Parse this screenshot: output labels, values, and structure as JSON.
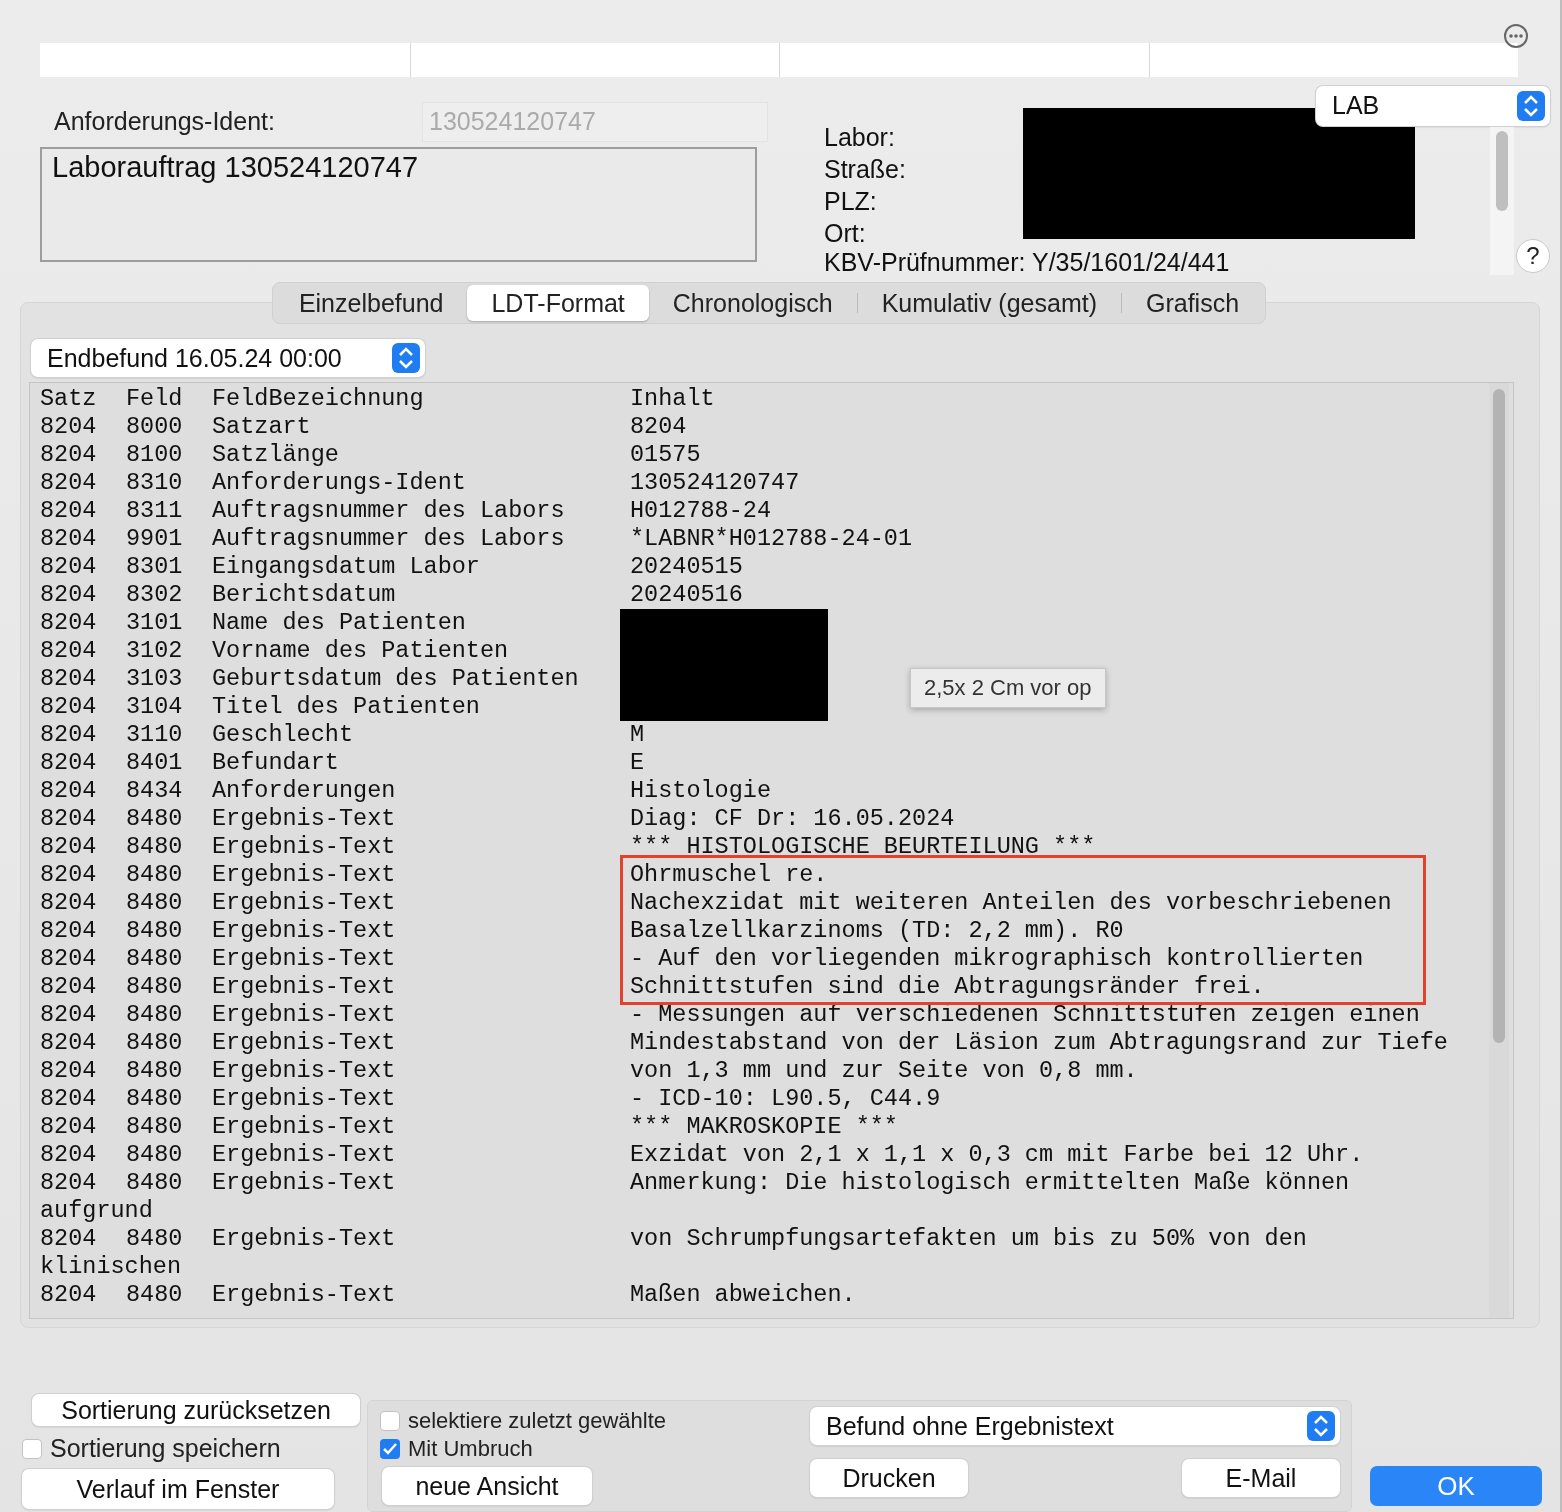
{
  "header": {
    "ident_label": "Anforderungs-Ident:",
    "ident_value": "130524120747",
    "order_text": "Laborauftrag 130524120747",
    "lab_labels": [
      "Labor:",
      "Straße:",
      "PLZ:",
      "Ort:"
    ],
    "kbv_label": "KBV-Prüfnummer:",
    "kbv_value": "Y/35/1601/24/441",
    "lab_select": "LAB",
    "help": "?"
  },
  "tabs": [
    {
      "label": "Einzelbefund",
      "selected": false
    },
    {
      "label": "LDT-Format",
      "selected": true
    },
    {
      "label": "Chronologisch",
      "selected": false
    },
    {
      "label": "Kumulativ (gesamt)",
      "selected": false
    },
    {
      "label": "Grafisch",
      "selected": false
    }
  ],
  "report_select": "Endbefund 16.05.24 00:00",
  "ldt": {
    "columns": [
      "Satz",
      "Feld",
      "FeldBezeichnung",
      "Inhalt"
    ],
    "rows": [
      {
        "kind": "field",
        "satz": "8204",
        "feld": "8000",
        "name": "Satzart",
        "content": "8204",
        "redacted": false,
        "highlighted": false
      },
      {
        "kind": "field",
        "satz": "8204",
        "feld": "8100",
        "name": "Satzlänge",
        "content": "01575",
        "redacted": false,
        "highlighted": false
      },
      {
        "kind": "field",
        "satz": "8204",
        "feld": "8310",
        "name": "Anforderungs-Ident",
        "content": "130524120747",
        "redacted": false,
        "highlighted": false
      },
      {
        "kind": "field",
        "satz": "8204",
        "feld": "8311",
        "name": "Auftragsnummer des Labors",
        "content": "H012788-24",
        "redacted": false,
        "highlighted": false
      },
      {
        "kind": "field",
        "satz": "8204",
        "feld": "9901",
        "name": "Auftragsnummer des Labors",
        "content": "*LABNR*H012788-24-01",
        "redacted": false,
        "highlighted": false
      },
      {
        "kind": "field",
        "satz": "8204",
        "feld": "8301",
        "name": "Eingangsdatum Labor",
        "content": "20240515",
        "redacted": false,
        "highlighted": false
      },
      {
        "kind": "field",
        "satz": "8204",
        "feld": "8302",
        "name": "Berichtsdatum",
        "content": "20240516",
        "redacted": false,
        "highlighted": false
      },
      {
        "kind": "field",
        "satz": "8204",
        "feld": "3101",
        "name": "Name des Patienten",
        "redacted": true,
        "highlighted": false
      },
      {
        "kind": "field",
        "satz": "8204",
        "feld": "3102",
        "name": "Vorname des Patienten",
        "redacted": true,
        "highlighted": false
      },
      {
        "kind": "field",
        "satz": "8204",
        "feld": "3103",
        "name": "Geburtsdatum des Patienten",
        "redacted": true,
        "highlighted": false
      },
      {
        "kind": "field",
        "satz": "8204",
        "feld": "3104",
        "name": "Titel des Patienten",
        "redacted": true,
        "highlighted": false
      },
      {
        "kind": "field",
        "satz": "8204",
        "feld": "3110",
        "name": "Geschlecht",
        "content": "M",
        "redacted": false,
        "highlighted": false
      },
      {
        "kind": "field",
        "satz": "8204",
        "feld": "8401",
        "name": "Befundart",
        "content": "E",
        "redacted": false,
        "highlighted": false
      },
      {
        "kind": "field",
        "satz": "8204",
        "feld": "8434",
        "name": "Anforderungen",
        "content": "Histologie",
        "redacted": false,
        "highlighted": false
      },
      {
        "kind": "field",
        "satz": "8204",
        "feld": "8480",
        "name": "Ergebnis-Text",
        "content": "Diag: CF Dr: 16.05.2024",
        "redacted": false,
        "highlighted": false
      },
      {
        "kind": "field",
        "satz": "8204",
        "feld": "8480",
        "name": "Ergebnis-Text",
        "content": "*** HISTOLOGISCHE BEURTEILUNG ***",
        "redacted": false,
        "highlighted": false
      },
      {
        "kind": "field",
        "satz": "8204",
        "feld": "8480",
        "name": "Ergebnis-Text",
        "content": "Ohrmuschel re.",
        "redacted": false,
        "highlighted": true
      },
      {
        "kind": "field",
        "satz": "8204",
        "feld": "8480",
        "name": "Ergebnis-Text",
        "content": "Nachexzidat mit weiteren Anteilen des vorbeschriebenen",
        "redacted": false,
        "highlighted": true
      },
      {
        "kind": "field",
        "satz": "8204",
        "feld": "8480",
        "name": "Ergebnis-Text",
        "content": "Basalzellkarzinoms (TD: 2,2 mm). R0",
        "redacted": false,
        "highlighted": true
      },
      {
        "kind": "field",
        "satz": "8204",
        "feld": "8480",
        "name": "Ergebnis-Text",
        "content": "- Auf den vorliegenden mikrographisch kontrollierten",
        "redacted": false,
        "highlighted": true
      },
      {
        "kind": "field",
        "satz": "8204",
        "feld": "8480",
        "name": "Ergebnis-Text",
        "content": "Schnittstufen sind die Abtragungsränder frei.",
        "redacted": false,
        "highlighted": true
      },
      {
        "kind": "field",
        "satz": "8204",
        "feld": "8480",
        "name": "Ergebnis-Text",
        "content": "- Messungen auf verschiedenen Schnittstufen zeigen einen",
        "redacted": false,
        "highlighted": false
      },
      {
        "kind": "field",
        "satz": "8204",
        "feld": "8480",
        "name": "Ergebnis-Text",
        "content": "Mindestabstand von der Läsion zum Abtragungsrand zur Tiefe",
        "redacted": false,
        "highlighted": false
      },
      {
        "kind": "field",
        "satz": "8204",
        "feld": "8480",
        "name": "Ergebnis-Text",
        "content": "von 1,3 mm und zur Seite von 0,8 mm.",
        "redacted": false,
        "highlighted": false
      },
      {
        "kind": "field",
        "satz": "8204",
        "feld": "8480",
        "name": "Ergebnis-Text",
        "content": "- ICD-10: L90.5, C44.9",
        "redacted": false,
        "highlighted": false
      },
      {
        "kind": "field",
        "satz": "8204",
        "feld": "8480",
        "name": "Ergebnis-Text",
        "content": "*** MAKROSKOPIE ***",
        "redacted": false,
        "highlighted": false
      },
      {
        "kind": "field",
        "satz": "8204",
        "feld": "8480",
        "name": "Ergebnis-Text",
        "content": "Exzidat von 2,1 x 1,1 x 0,3 cm mit Farbe bei 12 Uhr.",
        "redacted": false,
        "highlighted": false
      },
      {
        "kind": "field",
        "satz": "8204",
        "feld": "8480",
        "name": "Ergebnis-Text",
        "content": "Anmerkung: Die histologisch ermittelten Maße können",
        "redacted": false,
        "highlighted": false
      },
      {
        "kind": "wrap",
        "text": "aufgrund"
      },
      {
        "kind": "field",
        "satz": "8204",
        "feld": "8480",
        "name": "Ergebnis-Text",
        "content": "von Schrumpfungsartefakten um bis zu 50% von den",
        "redacted": false,
        "highlighted": false
      },
      {
        "kind": "wrap",
        "text": "klinischen"
      },
      {
        "kind": "field",
        "satz": "8204",
        "feld": "8480",
        "name": "Ergebnis-Text",
        "content": "Maßen abweichen.",
        "redacted": false,
        "highlighted": false
      }
    ]
  },
  "tooltip": "2,5x 2 Cm vor op",
  "bottom": {
    "reset_button": "Sortierung zurücksetzen",
    "save_sort": {
      "label": "Sortierung speichern",
      "checked": false
    },
    "window_button": "Verlauf im Fenster",
    "options": [
      {
        "label": "selektiere zuletzt gewählte",
        "checked": false
      },
      {
        "label": "Mit Umbruch",
        "checked": true
      }
    ],
    "new_view_button": "neue Ansicht",
    "print_select": "Befund ohne Ergebnistext",
    "print_button": "Drucken",
    "mail_button": "E-Mail",
    "ok_button": "OK"
  }
}
